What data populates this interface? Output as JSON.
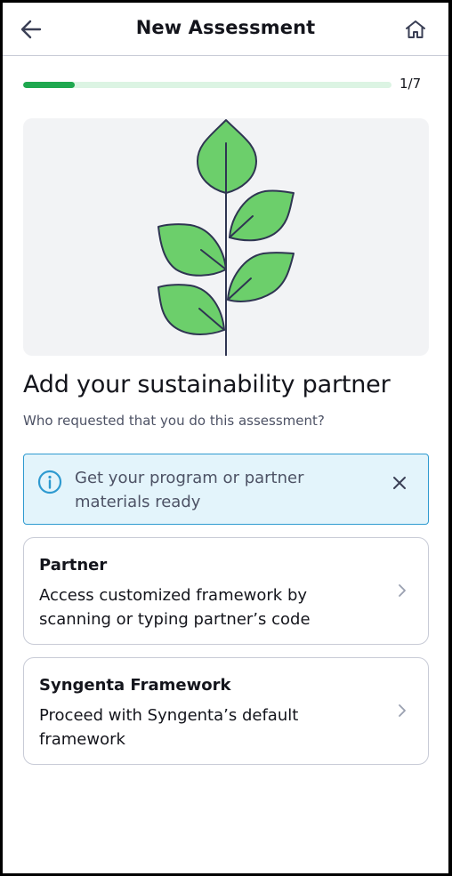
{
  "header": {
    "title": "New Assessment",
    "back_icon": "arrow-left-icon",
    "home_icon": "home-icon"
  },
  "progress": {
    "label": "1/7",
    "current": 1,
    "total": 7,
    "fill_fraction": 0.14,
    "fill_color": "#1fa84f",
    "track_color": "#dcf4e3"
  },
  "illustration": {
    "icon": "plant-branch-icon",
    "leaf_color": "#6ccf6b",
    "stroke_color": "#2f3552"
  },
  "main": {
    "heading": "Add your sustainability partner",
    "subheading": "Who requested that you do this assessment?"
  },
  "info_banner": {
    "icon": "info-icon",
    "text": "Get your program or partner materials ready",
    "close_icon": "close-icon",
    "accent_color": "#2e9ad0"
  },
  "options": [
    {
      "title": "Partner",
      "description": "Access customized framework by scanning or typing partner’s code",
      "chevron_icon": "chevron-right-icon"
    },
    {
      "title": "Syngenta Framework",
      "description": "Proceed with Syngenta’s default framework",
      "chevron_icon": "chevron-right-icon"
    }
  ]
}
